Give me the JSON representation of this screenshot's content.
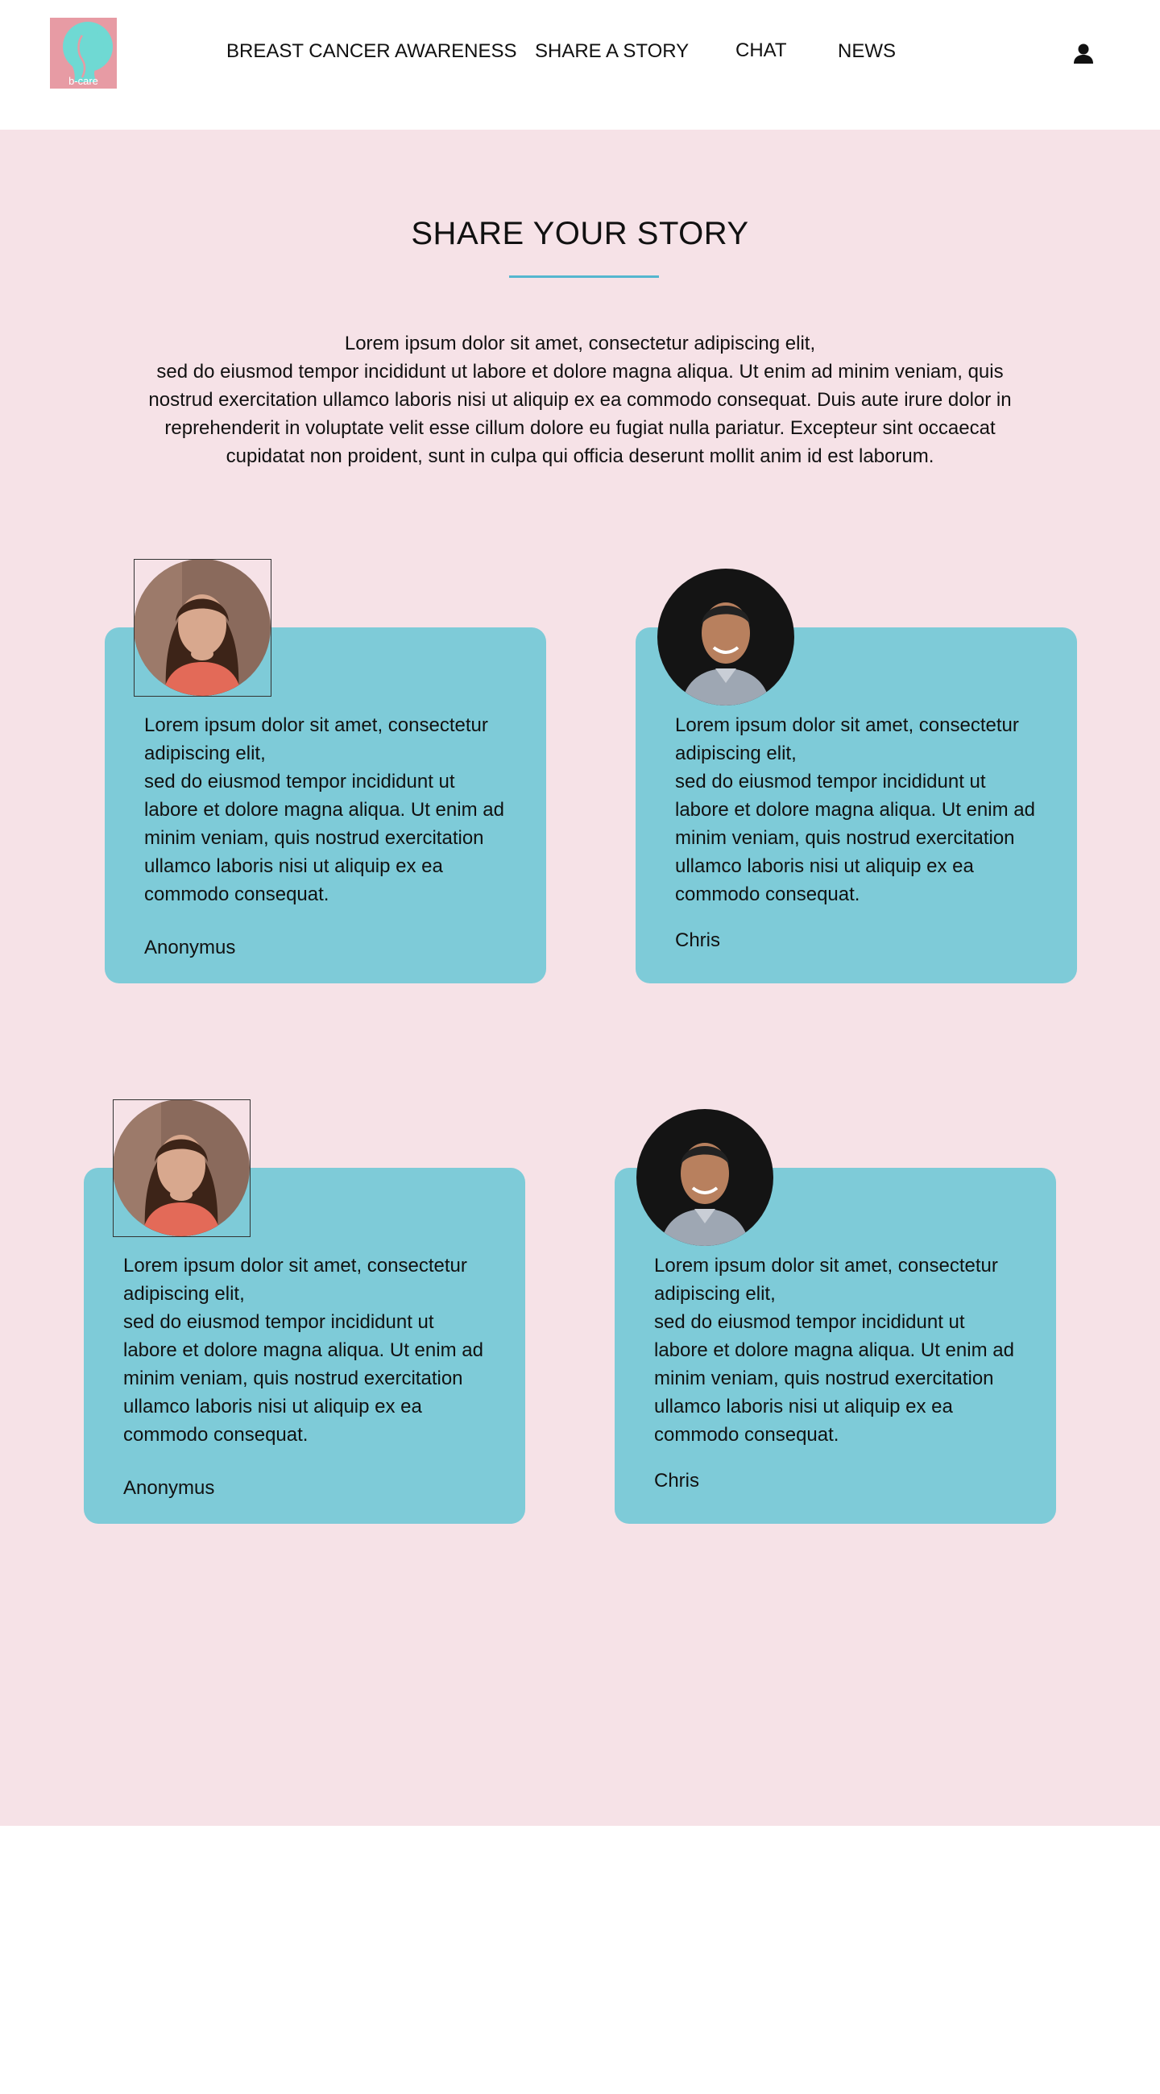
{
  "header": {
    "logo_text": "b-care",
    "nav": [
      {
        "label": "BREAST CANCER AWARENESS"
      },
      {
        "label": "SHARE A STORY"
      },
      {
        "label": "CHAT"
      },
      {
        "label": "NEWS"
      }
    ],
    "user_icon": "user-icon"
  },
  "main": {
    "title": "SHARE YOUR STORY",
    "intro_lines": [
      "Lorem ipsum dolor sit amet, consectetur adipiscing elit,",
      "sed do eiusmod tempor incididunt ut labore et dolore magna aliqua. Ut enim ad minim veniam, quis",
      "nostrud exercitation ullamco laboris nisi ut aliquip ex ea commodo consequat. Duis aute irure dolor in",
      "reprehenderit in voluptate velit esse cillum dolore eu fugiat nulla pariatur. Excepteur sint occaecat",
      "cupidatat non proident, sunt in culpa qui officia deserunt mollit anim id est laborum."
    ],
    "stories": [
      {
        "lines": [
          "Lorem ipsum dolor sit amet, consectetur",
          "adipiscing elit,",
          "sed do eiusmod tempor incididunt ut",
          "labore et dolore magna aliqua. Ut enim ad",
          "minim veniam, quis nostrud exercitation",
          "ullamco laboris nisi ut aliquip ex ea",
          "commodo consequat."
        ],
        "author": "Anonymus"
      },
      {
        "lines": [
          "Lorem ipsum dolor sit amet, consectetur",
          "adipiscing elit,",
          "sed do eiusmod tempor incididunt ut",
          "labore et dolore magna aliqua. Ut enim ad",
          "minim veniam, quis nostrud exercitation",
          "ullamco laboris nisi ut aliquip ex ea",
          "commodo consequat."
        ],
        "author": "Chris"
      },
      {
        "lines": [
          "Lorem ipsum dolor sit amet, consectetur",
          "adipiscing elit,",
          "sed do eiusmod tempor incididunt ut",
          "labore et dolore magna aliqua. Ut enim ad",
          "minim veniam, quis nostrud exercitation",
          "ullamco laboris nisi ut aliquip ex ea",
          "commodo consequat."
        ],
        "author": "Anonymus"
      },
      {
        "lines": [
          "Lorem ipsum dolor sit amet, consectetur",
          "adipiscing elit,",
          "sed do eiusmod tempor incididunt ut",
          "labore et dolore magna aliqua. Ut enim ad",
          "minim veniam, quis nostrud exercitation",
          "ullamco laboris nisi ut aliquip ex ea",
          "commodo consequat."
        ],
        "author": "Chris"
      }
    ]
  },
  "colors": {
    "page_background": "#f6e2e7",
    "card": "#7ecbd8",
    "accent_underline": "#55b6cf",
    "logo_background": "#e79ba4",
    "logo_figure": "#6fd9d3"
  }
}
